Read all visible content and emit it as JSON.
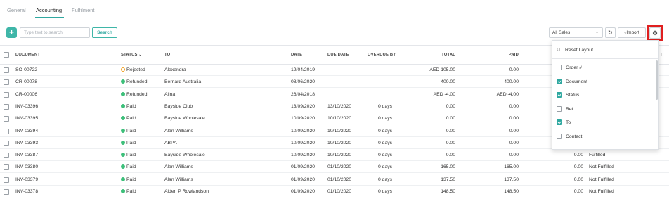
{
  "tabs": [
    {
      "label": "General"
    },
    {
      "label": "Accounting"
    },
    {
      "label": "Fulfilment"
    }
  ],
  "toolbar": {
    "add_label": "+",
    "search_placeholder": "Type text to search",
    "search_value": "",
    "search_button": "Search",
    "sales_filter": "All Sales",
    "import_label": "Import"
  },
  "table": {
    "headers": {
      "document": "DOCUMENT",
      "status": "STATUS",
      "to": "TO",
      "date": "DATE",
      "due_date": "DUE DATE",
      "overdue_by": "OVERDUE BY",
      "total": "TOTAL",
      "paid": "PAID",
      "partial": "T"
    },
    "rows": [
      {
        "document": "SO-00722",
        "status": "Rejected",
        "status_type": "rejected",
        "to": "Alexandra",
        "date": "19/04/2019",
        "due": "",
        "overdue": "",
        "total": "AED 105.00",
        "paid": "0.00",
        "extra_num": "",
        "extra_text": ""
      },
      {
        "document": "CR-00078",
        "status": "Refunded",
        "status_type": "ok",
        "to": "Bernard Australia",
        "date": "08/06/2020",
        "due": "",
        "overdue": "",
        "total": "-400.00",
        "paid": "-400.00",
        "extra_num": "",
        "extra_text": ""
      },
      {
        "document": "CR-00006",
        "status": "Refunded",
        "status_type": "ok",
        "to": "Alina",
        "date": "26/04/2018",
        "due": "",
        "overdue": "",
        "total": "AED -4.00",
        "paid": "AED -4.00",
        "extra_num": "",
        "extra_text": ""
      },
      {
        "document": "INV-03396",
        "status": "Paid",
        "status_type": "ok",
        "to": "Bayside Club",
        "date": "13/09/2020",
        "due": "13/10/2020",
        "overdue": "0 days",
        "total": "0.00",
        "paid": "0.00",
        "extra_num": "",
        "extra_text": ""
      },
      {
        "document": "INV-03395",
        "status": "Paid",
        "status_type": "ok",
        "to": "Bayside Wholesale",
        "date": "10/09/2020",
        "due": "10/10/2020",
        "overdue": "0 days",
        "total": "0.00",
        "paid": "0.00",
        "extra_num": "",
        "extra_text": ""
      },
      {
        "document": "INV-03394",
        "status": "Paid",
        "status_type": "ok",
        "to": "Alan Williams",
        "date": "10/09/2020",
        "due": "10/10/2020",
        "overdue": "0 days",
        "total": "0.00",
        "paid": "0.00",
        "extra_num": "",
        "extra_text": ""
      },
      {
        "document": "INV-03393",
        "status": "Paid",
        "status_type": "ok",
        "to": "ABPA",
        "date": "10/09/2020",
        "due": "10/10/2020",
        "overdue": "0 days",
        "total": "0.00",
        "paid": "0.00",
        "extra_num": "",
        "extra_text": ""
      },
      {
        "document": "INV-03387",
        "status": "Paid",
        "status_type": "ok",
        "to": "Bayside Wholesale",
        "date": "10/09/2020",
        "due": "10/10/2020",
        "overdue": "0 days",
        "total": "0.00",
        "paid": "0.00",
        "extra_num": "0.00",
        "extra_text": "Fulfilled"
      },
      {
        "document": "INV-03380",
        "status": "Paid",
        "status_type": "ok",
        "to": "Alan Williams",
        "date": "01/09/2020",
        "due": "01/10/2020",
        "overdue": "0 days",
        "total": "165.00",
        "paid": "165.00",
        "extra_num": "0.00",
        "extra_text": "Not Fulfilled"
      },
      {
        "document": "INV-03379",
        "status": "Paid",
        "status_type": "ok",
        "to": "Alan Williams",
        "date": "01/09/2020",
        "due": "01/10/2020",
        "overdue": "0 days",
        "total": "137.50",
        "paid": "137.50",
        "extra_num": "0.00",
        "extra_text": "Not Fulfilled"
      },
      {
        "document": "INV-03378",
        "status": "Paid",
        "status_type": "ok",
        "to": "Aiden P Rowlandson",
        "date": "01/09/2020",
        "due": "01/10/2020",
        "overdue": "0 days",
        "total": "148.50",
        "paid": "148.50",
        "extra_num": "0.00",
        "extra_text": "Not Fulfilled"
      }
    ]
  },
  "column_menu": {
    "reset_label": "Reset Layout",
    "items": [
      {
        "label": "Order #",
        "checked": false
      },
      {
        "label": "Document",
        "checked": true
      },
      {
        "label": "Status",
        "checked": true
      },
      {
        "label": "Ref",
        "checked": false
      },
      {
        "label": "To",
        "checked": true
      },
      {
        "label": "Contact",
        "checked": false
      }
    ]
  },
  "colors": {
    "accent": "#2fa8a0",
    "paid_status": "#3dbf7a",
    "rejected_status": "#f0a020",
    "highlight": "#e02020"
  }
}
